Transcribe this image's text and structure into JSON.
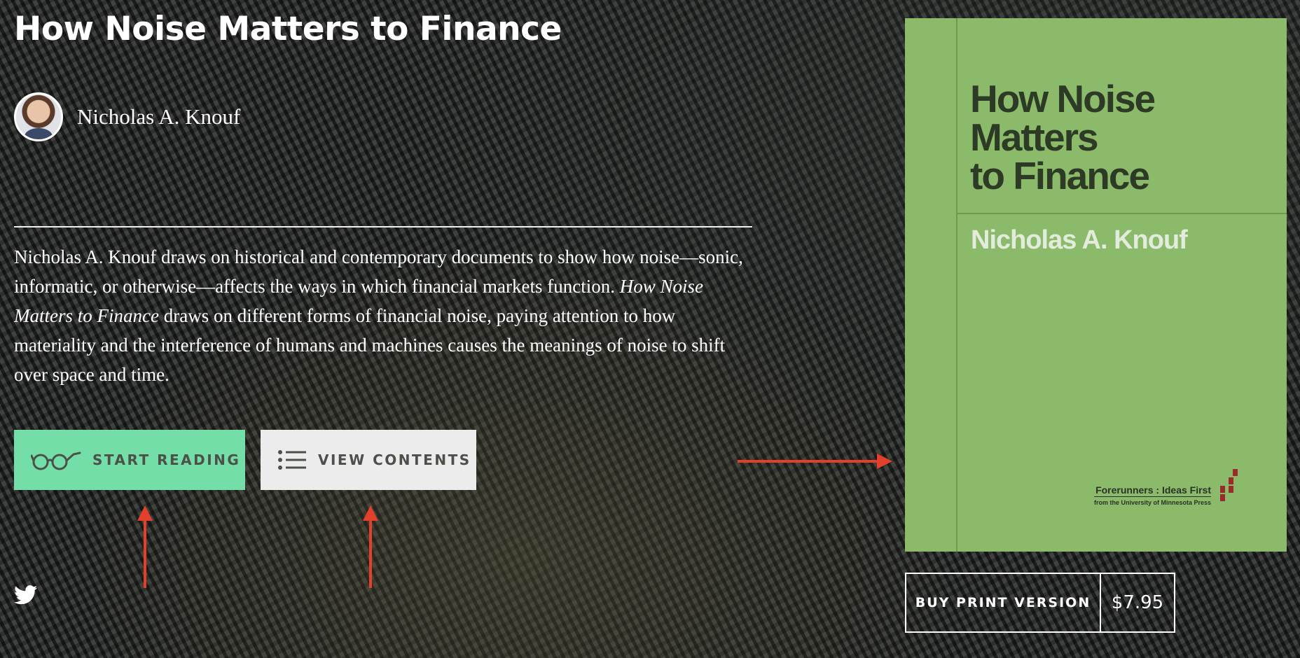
{
  "book": {
    "title": "How Noise Matters to Finance",
    "author": "Nicholas A. Knouf",
    "description_part1": "Nicholas A. Knouf draws on historical and contemporary documents to show how noise—sonic, informatic, or otherwise—affects the ways in which financial markets function. ",
    "description_title_italic": "How Noise Matters to Finance",
    "description_part2": " draws on different forms of financial noise, paying attention to how materiality and the interference of humans and machines causes the meanings of noise to shift over space and time."
  },
  "actions": {
    "start_reading": "START READING",
    "view_contents": "VIEW CONTENTS",
    "buy_print": "BUY PRINT VERSION",
    "price": "$7.95"
  },
  "cover": {
    "title": "How Noise\nMatters\nto Finance",
    "author": "Nicholas A. Knouf",
    "series_name": "Forerunners : Ideas First",
    "series_sub": "from the University of Minnesota Press"
  },
  "icons": {
    "start_reading": "glasses-icon",
    "view_contents": "list-icon",
    "social": "twitter-icon"
  },
  "colors": {
    "start_button": "#74dea9",
    "contents_button": "#ececec",
    "cover_background": "#8bbb6a",
    "annotation_arrow": "#e2402b"
  }
}
